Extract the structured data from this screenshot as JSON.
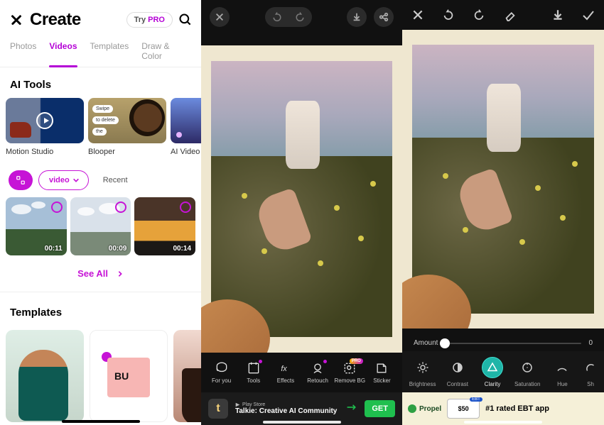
{
  "panel1": {
    "title": "Create",
    "try_label": "Try ",
    "pro_label": "PRO",
    "tabs": [
      "Photos",
      "Videos",
      "Templates",
      "Draw & Color"
    ],
    "active_tab_index": 1,
    "ai_heading": "AI Tools",
    "ai_items": [
      {
        "label": "Motion Studio"
      },
      {
        "label": "Blooper",
        "pills": [
          "Swipe",
          "to delete",
          "the"
        ]
      },
      {
        "label": "AI Video"
      }
    ],
    "filter": {
      "video_label": "video",
      "recent_label": "Recent"
    },
    "videos": [
      {
        "duration": "00:11"
      },
      {
        "duration": "00:09"
      },
      {
        "duration": "00:14"
      }
    ],
    "see_all": "See All",
    "templates_heading": "Templates",
    "template_bu": "BU"
  },
  "panel2": {
    "tools": [
      {
        "key": "foryou",
        "label": "For you"
      },
      {
        "key": "tools",
        "label": "Tools",
        "dot": true
      },
      {
        "key": "effects",
        "label": "Effects"
      },
      {
        "key": "retouch",
        "label": "Retouch",
        "dot": true
      },
      {
        "key": "removebg",
        "label": "Remove BG",
        "pro": true
      },
      {
        "key": "sticker",
        "label": "Sticker"
      }
    ],
    "pro_badge": "PRO",
    "ad": {
      "icon_letter": "t",
      "store": "Play Store",
      "title": "Talkie: Creative AI Community",
      "cta": "GET"
    }
  },
  "panel3": {
    "amount_label": "Amount",
    "amount_value": "0",
    "tools": [
      {
        "label": "Brightness"
      },
      {
        "label": "Contrast"
      },
      {
        "label": "Clarity",
        "active": true
      },
      {
        "label": "Saturation"
      },
      {
        "label": "Hue"
      },
      {
        "label": "Sh"
      }
    ],
    "ad": {
      "propel": "Propel",
      "ebt_tag": "EBT",
      "ebt_amount": "$50",
      "text": "#1 rated EBT app"
    }
  }
}
